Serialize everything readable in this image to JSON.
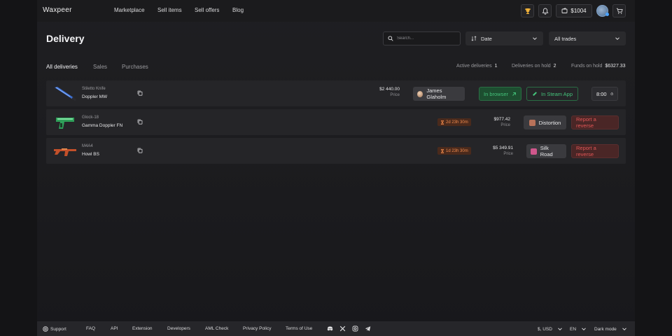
{
  "header": {
    "logo": "Waxpeer",
    "nav": [
      "Marketplace",
      "Sell items",
      "Sell offers",
      "Blog"
    ],
    "balance": "$1004"
  },
  "page": {
    "title": "Delivery",
    "search": {
      "placeholder": "Search..."
    },
    "sort_select": "Date",
    "filter_select": "All trades"
  },
  "tabs": [
    "All deliveries",
    "Sales",
    "Purchases"
  ],
  "stats": {
    "active_label": "Active deliveries",
    "active_value": "1",
    "hold_label": "Deliveries on hold",
    "hold_value": "2",
    "funds_label": "Funds on hold",
    "funds_value": "$6327.33"
  },
  "price_label": "Price",
  "rows": [
    {
      "type": "Stiletto Knife",
      "name": "Doppler MW",
      "price": "$2 440.00",
      "user": "James Glaholm",
      "browser_label": "In browser",
      "steam_label": "In Steam App",
      "timer": "8:00"
    },
    {
      "type": "Glock-18",
      "name": "Gamma Doppler FN",
      "hold": "2d 23h 30m",
      "price": "$977.42",
      "partner": "Distortion",
      "reverse_label": "Report a reverse"
    },
    {
      "type": "M4A4",
      "name": "Howl BS",
      "hold": "1d 23h 30m",
      "price": "$5 349.91",
      "partner": "Silk Road",
      "reverse_label": "Report a reverse"
    }
  ],
  "footer": {
    "support": "Support",
    "links": [
      "FAQ",
      "API",
      "Extension",
      "Developers",
      "AML Check",
      "Privacy Policy",
      "Terms of Use"
    ],
    "currency": "$, USD",
    "language": "EN",
    "theme": "Dark mode"
  },
  "colors": {
    "background": "#1c1c1f",
    "row": "#252528",
    "green": "#44c27a",
    "orange": "#f08a4c",
    "red": "#e25656"
  },
  "icons": [
    "trophy-icon",
    "bell-icon",
    "wallet-icon",
    "cart-icon",
    "search-icon",
    "sort-icon",
    "chevron-down-icon",
    "copy-icon",
    "arrow-up-right-icon",
    "steam-icon",
    "stopwatch-icon",
    "hourglass-icon",
    "support-icon",
    "discord-icon",
    "x-icon",
    "instagram-icon",
    "telegram-icon"
  ]
}
